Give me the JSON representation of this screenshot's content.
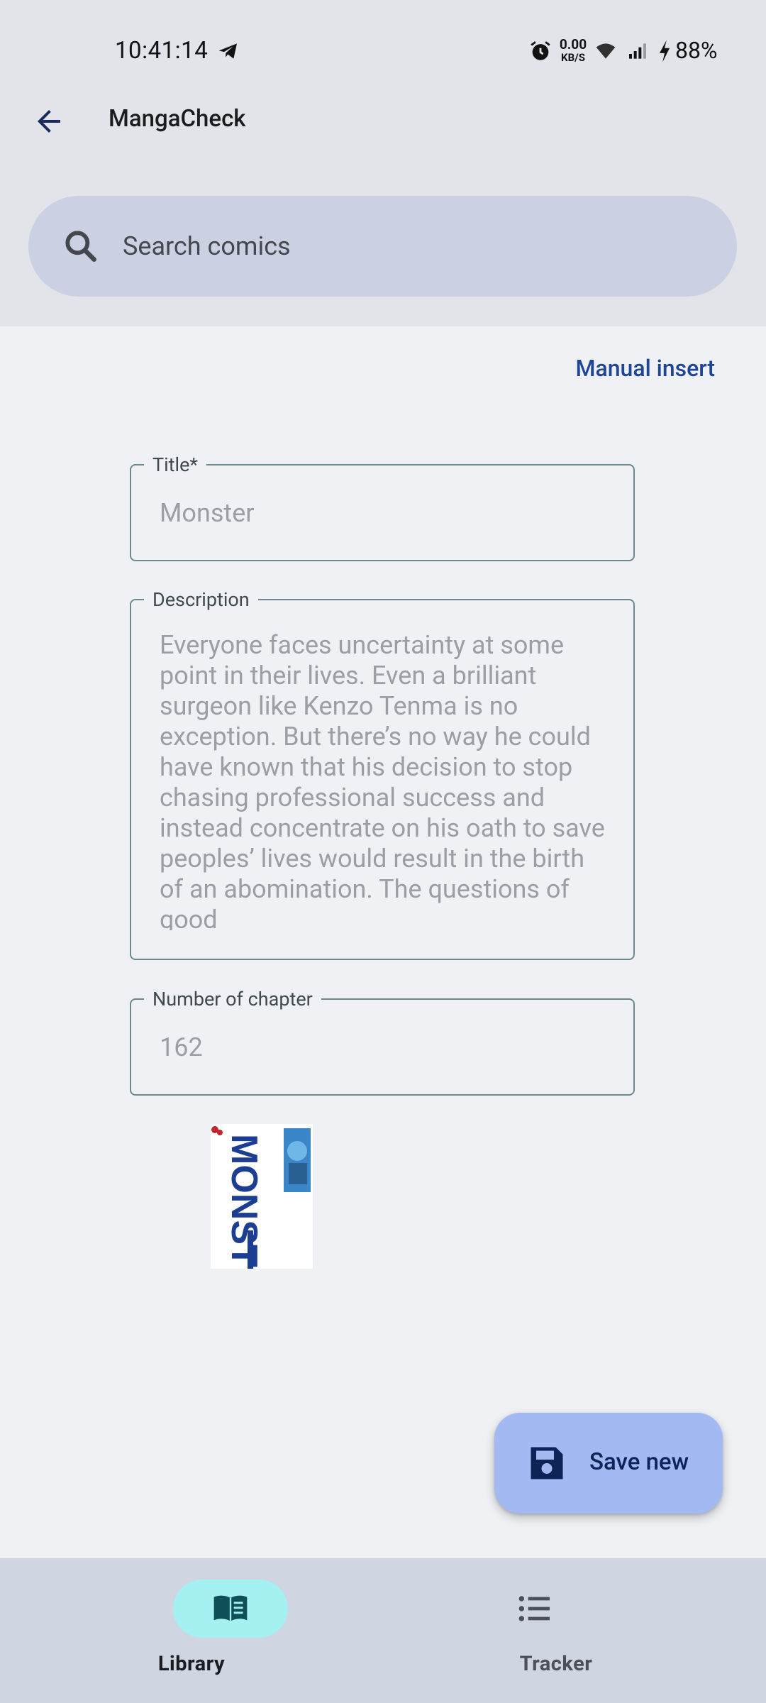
{
  "status_bar": {
    "time": "10:41:14",
    "net_speed_value": "0.00",
    "net_speed_unit": "KB/S",
    "battery": "88%"
  },
  "app_bar": {
    "title": "MangaCheck"
  },
  "search": {
    "placeholder": "Search comics"
  },
  "actions": {
    "manual_insert": "Manual insert"
  },
  "form": {
    "title_label": "Title*",
    "title_value": "Monster",
    "description_label": "Description",
    "description_value": "Everyone faces uncertainty at some point in their lives. Even a brilliant surgeon like Kenzo Tenma is no exception. But there’s no way he could have known that his decision to stop chasing professional success and instead concentrate on his oath to save peoples’ lives would result in the birth of an abomination. The questions of good",
    "chapters_label": "Number of chapter",
    "chapters_value": "162"
  },
  "cover": {
    "title_text": "MONSTER"
  },
  "fab": {
    "label": "Save new",
    "icon": "save-icon"
  },
  "bottom_nav": {
    "items": [
      {
        "label": "Library",
        "icon": "book-icon",
        "selected": true
      },
      {
        "label": "Tracker",
        "icon": "list-icon",
        "selected": false
      }
    ]
  },
  "colors": {
    "accent": "#1f4596",
    "fab_bg": "#a3b9f2",
    "nav_pill": "#a5f0f1"
  }
}
